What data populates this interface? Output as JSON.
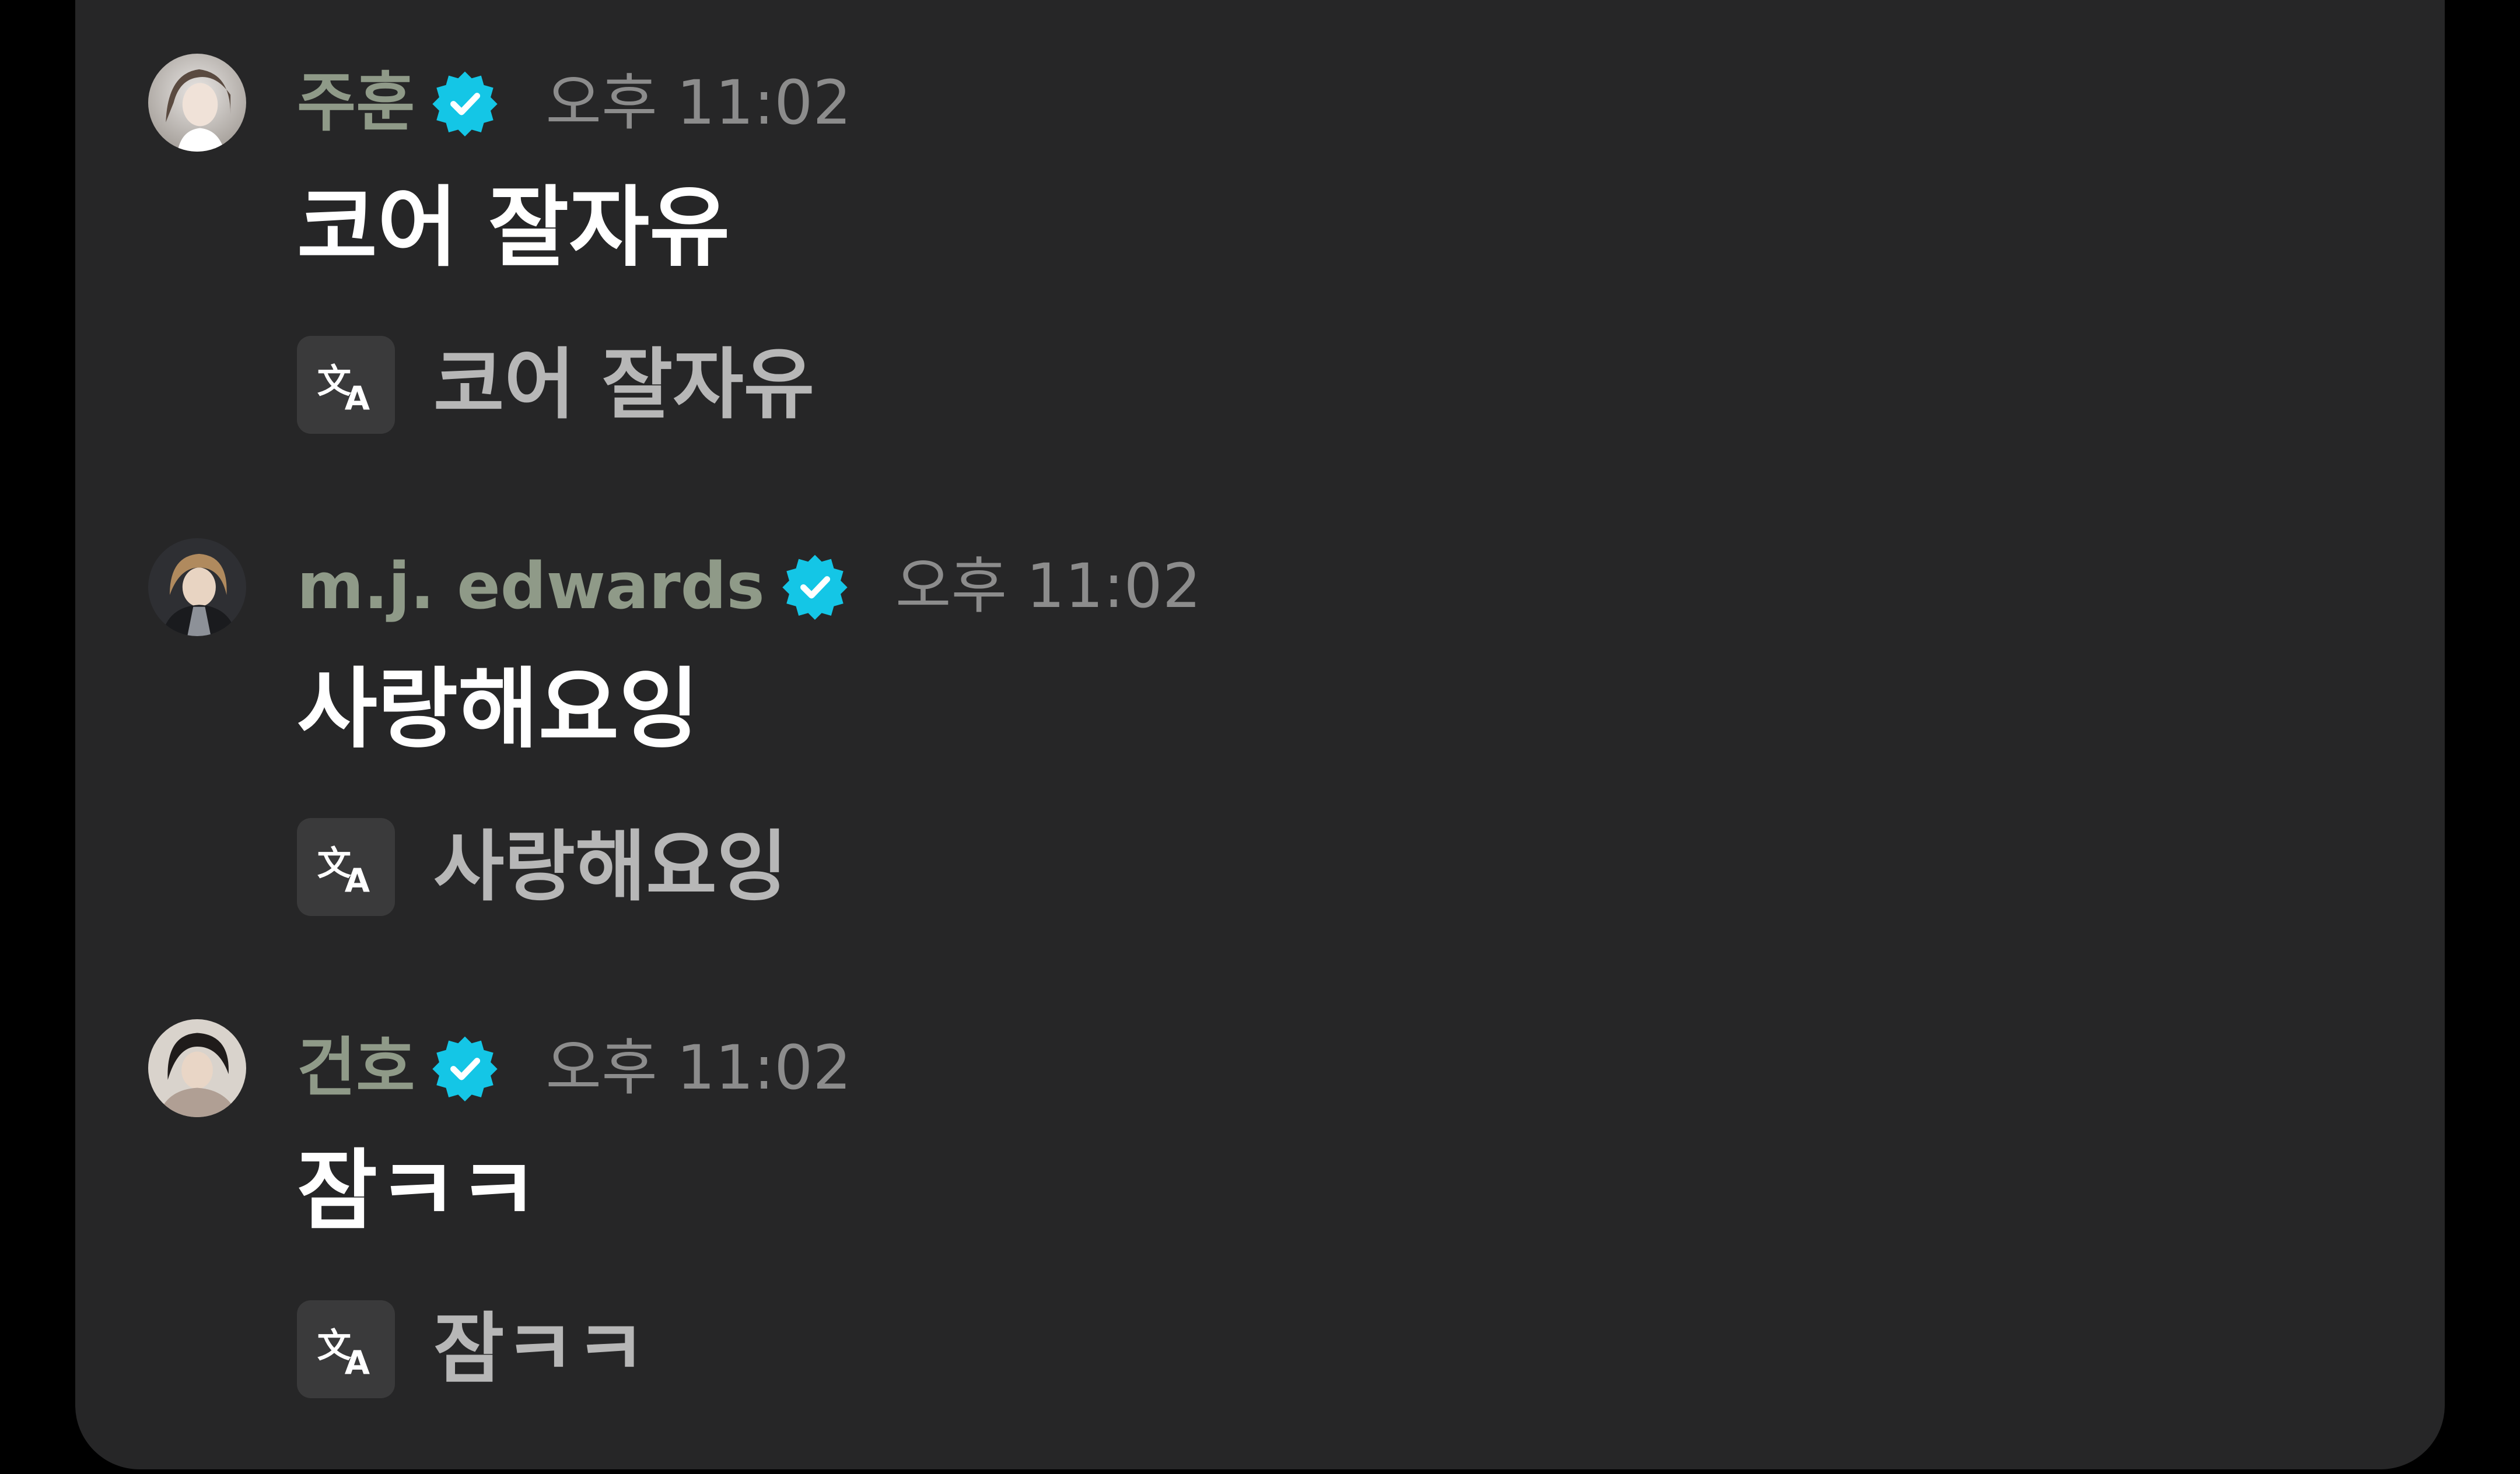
{
  "messages": [
    {
      "username": "주훈",
      "time": "오후 11:02",
      "text": "코어 잘자유",
      "translation": "코어 잘자유",
      "avatar_icon": "avatar-photo",
      "verified_icon": "verified-badge-icon"
    },
    {
      "username": "m.j. edwards",
      "time": "오후 11:02",
      "text": "사랑해요잉",
      "translation": "사랑해요잉",
      "avatar_icon": "avatar-photo",
      "verified_icon": "verified-badge-icon"
    },
    {
      "username": "건호",
      "time": "오후 11:02",
      "text": "잠ㅋㅋ",
      "translation": "잠ㅋㅋ",
      "avatar_icon": "avatar-photo",
      "verified_icon": "verified-badge-icon"
    }
  ],
  "colors": {
    "background": "#000000",
    "panel": "#262627",
    "username": "#8f9a88",
    "timestamp": "#8c8c8c",
    "message_text": "#ffffff",
    "translated_text": "#b7b7b7",
    "verified_badge": "#14c6e6",
    "translate_chip": "#3a3a3b"
  },
  "icons": {
    "translate": "translate-icon",
    "verified": "verified-badge-icon"
  }
}
